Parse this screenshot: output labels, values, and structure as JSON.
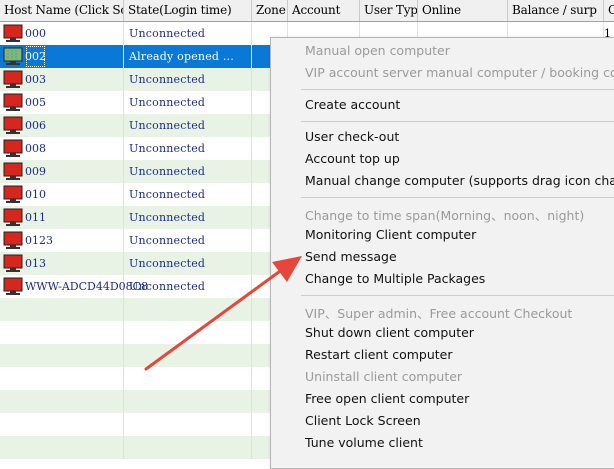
{
  "header": {
    "columns": [
      "Host Name (Click So",
      "State(Login time)",
      "Zone",
      "Account",
      "User Typ",
      "Online",
      "Balance / surp",
      "C"
    ]
  },
  "rows": [
    {
      "host": "000",
      "state": "Unconnected"
    },
    {
      "host": "002",
      "state": "Already opened  ..."
    },
    {
      "host": "003",
      "state": "Unconnected"
    },
    {
      "host": "005",
      "state": "Unconnected"
    },
    {
      "host": "006",
      "state": "Unconnected"
    },
    {
      "host": "008",
      "state": "Unconnected"
    },
    {
      "host": "009",
      "state": "Unconnected"
    },
    {
      "host": "010",
      "state": "Unconnected"
    },
    {
      "host": "011",
      "state": "Unconnected"
    },
    {
      "host": "0123",
      "state": "Unconnected"
    },
    {
      "host": "013",
      "state": "Unconnected"
    },
    {
      "host": "WWW-ADCD44D08C8",
      "state": "Unconnected"
    }
  ],
  "first_row_extra": "1",
  "context_menu": {
    "items": [
      {
        "label": "Manual open computer",
        "disabled": true
      },
      {
        "label": "VIP account server manual computer / booking comp",
        "disabled": true
      },
      {
        "label": "Create account",
        "disabled": false
      },
      {
        "label": "User check-out",
        "disabled": false
      },
      {
        "label": "Account top up",
        "disabled": false
      },
      {
        "label": "Manual change computer (supports drag icon change",
        "disabled": false
      },
      {
        "label": "Change to time span(Morning、noon、night)",
        "disabled": true
      },
      {
        "label": "Monitoring Client computer",
        "disabled": false
      },
      {
        "label": "Send message",
        "disabled": false
      },
      {
        "label": "Change to Multiple Packages",
        "disabled": false
      },
      {
        "label": "VIP、Super admin、Free account Checkout",
        "disabled": true
      },
      {
        "label": "Shut down client computer",
        "disabled": false
      },
      {
        "label": "Restart client computer",
        "disabled": false
      },
      {
        "label": "Uninstall client computer",
        "disabled": true
      },
      {
        "label": "Free open client computer",
        "disabled": false
      },
      {
        "label": "Client Lock Screen",
        "disabled": false
      },
      {
        "label": "Tune  volume client",
        "disabled": false
      }
    ]
  },
  "colors": {
    "selected_row": "#0a78d7",
    "alt_row": "#e8f3e5",
    "annotation_arrow": "#e8463a",
    "pc_icon": "#d7261e"
  }
}
